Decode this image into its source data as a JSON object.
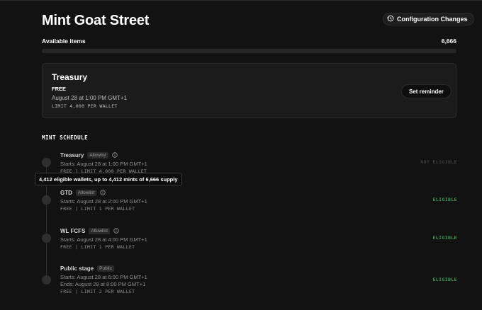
{
  "header": {
    "title": "Mint Goat Street",
    "config_button": "Configuration Changes"
  },
  "availability": {
    "label": "Available items",
    "count": "6,666",
    "progress_fraction": 0.0
  },
  "current_stage": {
    "name": "Treasury",
    "price": "FREE",
    "date": "August 28 at 1:00 PM GMT+1",
    "limit": "LIMIT 4,000 PER WALLET",
    "reminder_button": "Set reminder"
  },
  "schedule": {
    "title": "MINT SCHEDULE",
    "stages": [
      {
        "name": "Treasury",
        "badge": "Allowlist",
        "starts": "Starts: August 28 at 1:00 PM GMT+1",
        "limit": "FREE | LIMIT 4,000 PER WALLET",
        "status": "NOT ELIGIBLE"
      },
      {
        "name": "GTD",
        "badge": "Allowlist",
        "starts": "Starts: August 28 at 2:00 PM GMT+1",
        "limit": "FREE | LIMIT 1 PER WALLET",
        "status": "ELIGIBLE"
      },
      {
        "name": "WL FCFS",
        "badge": "Allowlist",
        "starts": "Starts: August 28 at 4:00 PM GMT+1",
        "limit": "FREE | LIMIT 1 PER WALLET",
        "status": "ELIGIBLE"
      },
      {
        "name": "Public stage",
        "badge": "Public",
        "starts": "Starts: August 28 at 6:00 PM GMT+1",
        "ends": "Ends: August 28 at 8:00 PM GMT+1",
        "limit": "FREE | LIMIT 2 PER WALLET",
        "status": "ELIGIBLE"
      }
    ]
  },
  "tooltip": "4,412 eligible wallets, up to 4,412 mints of 6,666 supply",
  "icons": {
    "config": "history-icon",
    "info": "info-icon"
  },
  "colors": {
    "background": "#121212",
    "eligible": "#3d9a53",
    "not_eligible": "#3f3f3f"
  }
}
